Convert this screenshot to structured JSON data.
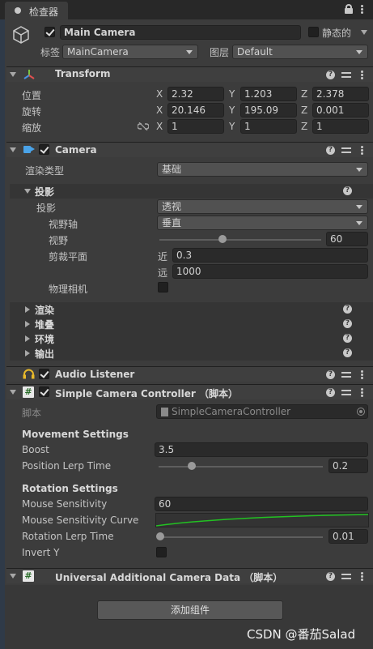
{
  "tab": {
    "label": "检查器"
  },
  "object": {
    "name": "Main Camera",
    "static_label": "静态的",
    "tag_label": "标签",
    "tag_value": "MainCamera",
    "layer_label": "图层",
    "layer_value": "Default"
  },
  "transform": {
    "title": "Transform",
    "position": {
      "label": "位置",
      "x": "2.32",
      "y": "1.203",
      "z": "2.378"
    },
    "rotation": {
      "label": "旋转",
      "x": "20.146",
      "y": "195.09",
      "z": "0.001"
    },
    "scale": {
      "label": "缩放",
      "x": "1",
      "y": "1",
      "z": "1"
    },
    "axis_x": "X",
    "axis_y": "Y",
    "axis_z": "Z"
  },
  "camera": {
    "title": "Camera",
    "render_type_label": "渲染类型",
    "render_type_value": "基础",
    "projection_header": "投影",
    "projection_label": "投影",
    "projection_value": "透视",
    "fov_axis_label": "视野轴",
    "fov_axis_value": "垂直",
    "fov_label": "视野",
    "fov_value": "60",
    "fov_fraction": 0.39,
    "clip_label": "剪裁平面",
    "near_label": "近",
    "near_value": "0.3",
    "far_label": "远",
    "far_value": "1000",
    "physical_label": "物理相机",
    "sections": [
      "渲染",
      "堆叠",
      "环境",
      "输出"
    ]
  },
  "audio": {
    "title": "Audio Listener"
  },
  "controller": {
    "title": "Simple Camera Controller （脚本）",
    "script_label": "脚本",
    "script_value": "SimpleCameraController",
    "movement_header": "Movement Settings",
    "boost_label": "Boost",
    "boost_value": "3.5",
    "pos_lerp_label": "Position Lerp Time",
    "pos_lerp_value": "0.2",
    "pos_lerp_fraction": 0.2,
    "rotation_header": "Rotation Settings",
    "mouse_sens_label": "Mouse Sensitivity",
    "mouse_sens_value": "60",
    "mouse_curve_label": "Mouse Sensitivity Curve",
    "rot_lerp_label": "Rotation Lerp Time",
    "rot_lerp_value": "0.01",
    "rot_lerp_fraction": 0.01,
    "invert_label": "Invert Y"
  },
  "urp": {
    "title": "Universal Additional Camera Data （脚本）"
  },
  "add_component": {
    "label": "添加组件"
  },
  "watermark": "CSDN @番茄Salad",
  "colors": {
    "curve": "#22c222",
    "camera_icon": "#4aa3e8",
    "audio_icon": "#e8b92a"
  }
}
